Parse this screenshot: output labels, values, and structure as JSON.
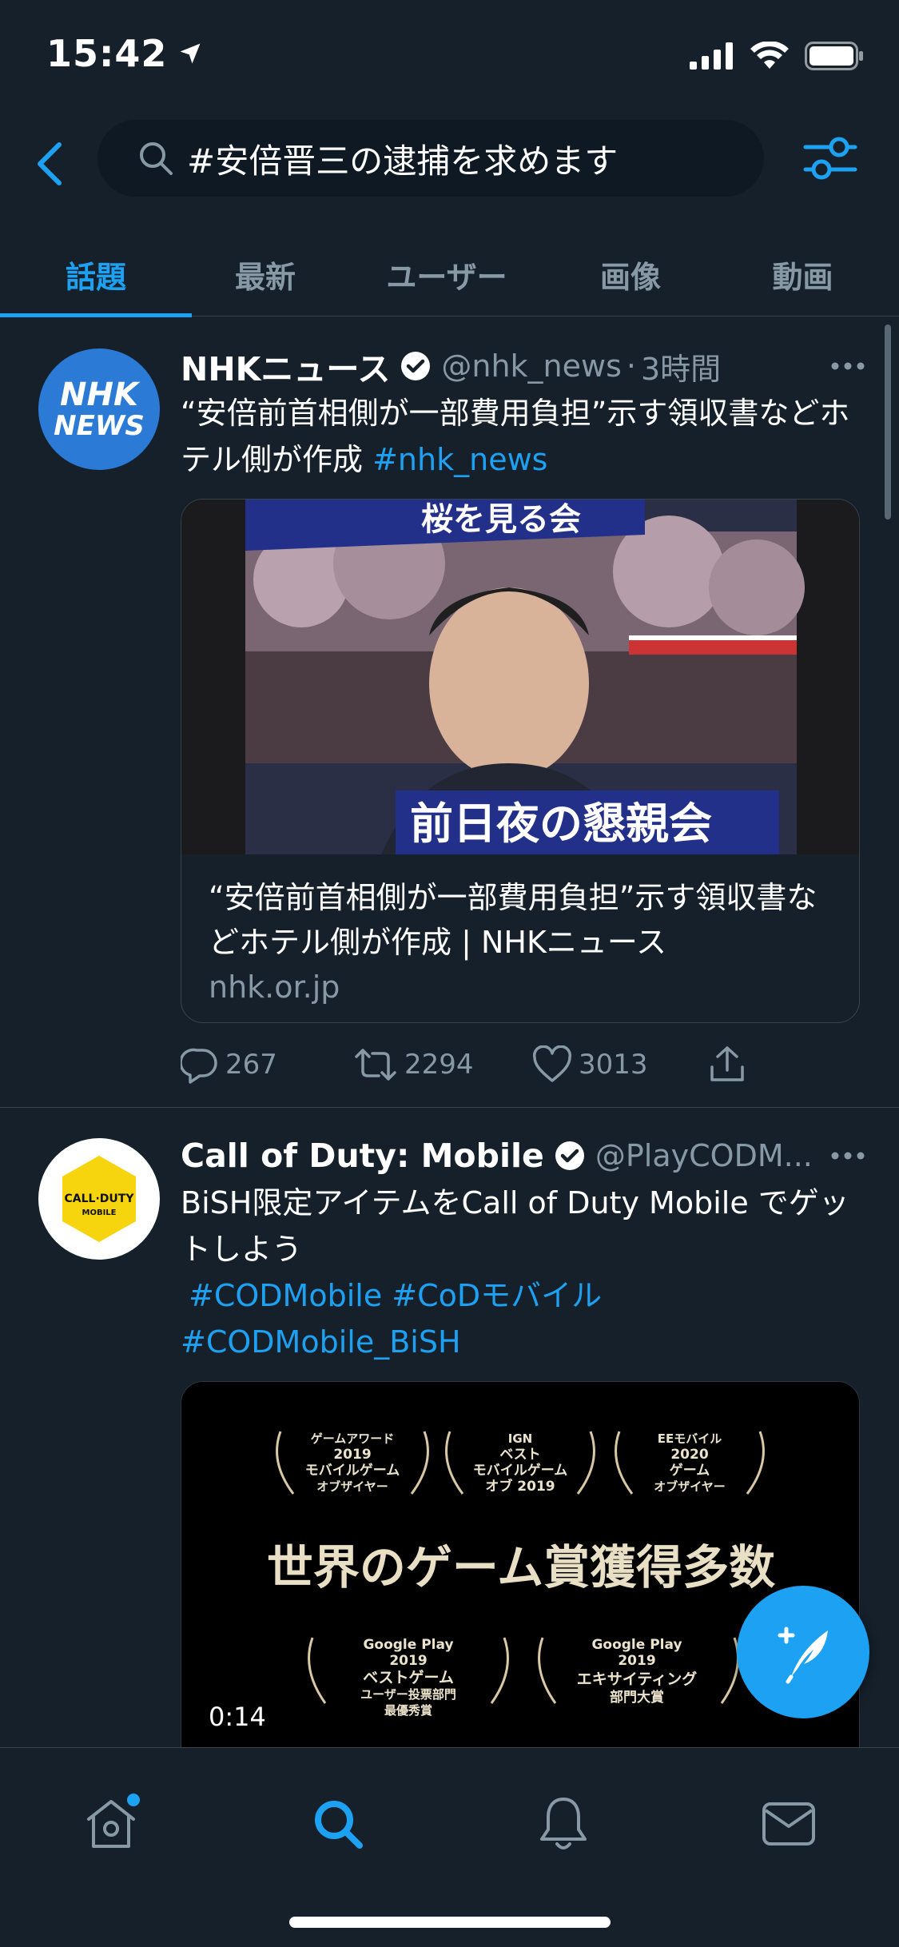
{
  "status_bar": {
    "time": "15:42"
  },
  "search": {
    "query": "#安倍晋三の逮捕を求めます"
  },
  "tabs": [
    {
      "label": "話題",
      "active": true
    },
    {
      "label": "最新",
      "active": false
    },
    {
      "label": "ユーザー",
      "active": false
    },
    {
      "label": "画像",
      "active": false
    },
    {
      "label": "動画",
      "active": false
    }
  ],
  "tweets": [
    {
      "display_name": "NHKニュース",
      "handle": "@nhk_news",
      "time": "3時間",
      "avatar_text": [
        "NHK",
        "NEWS"
      ],
      "avatar_color": "#2b7bd6",
      "text": "“安倍前首相側が一部費用負担”示す領収書などホテル側が作成 ",
      "hashtags": [
        "#nhk_news"
      ],
      "card": {
        "image_top_caption": "桜を見る会",
        "image_bottom_caption": "前日夜の懇親会",
        "title": "“安倍前首相側が一部費用負担”示す領収書などホテル側が作成 | NHKニュース",
        "domain": "nhk.or.jp"
      },
      "actions": {
        "replies": "267",
        "retweets": "2294",
        "likes": "3013"
      }
    },
    {
      "display_name": "Call of Duty: Mobile",
      "handle": "@PlayCODM...",
      "avatar_text": [
        "CALL·DUTY",
        "MOBILE"
      ],
      "text": "BiSH限定アイテムをCall of Duty Mobile でゲットしよう",
      "hashtags": [
        "#CODMobile",
        "#CoDモバイル",
        "#CODMobile_BiSH"
      ],
      "video": {
        "awards_top": [
          [
            "ゲームアワード",
            "2019",
            "モバイルゲーム",
            "オブザイヤー"
          ],
          [
            "IGN",
            "ベスト",
            "モバイルゲーム",
            "オブ 2019"
          ],
          [
            "EEモバイル",
            "2020",
            "ゲーム",
            "オブザイヤー"
          ]
        ],
        "headline": "世界のゲーム賞獲得多数",
        "awards_bottom": [
          [
            "Google Play",
            "2019",
            "ベストゲーム",
            "ユーザー投票部門",
            "最優秀賞"
          ],
          [
            "Google Play",
            "2019",
            "エキサイティング",
            "部門大賞"
          ]
        ],
        "duration": "0:14"
      }
    }
  ],
  "colors": {
    "background": "#15202b",
    "accent": "#1da1f2",
    "secondary_text": "#8899a6",
    "divider": "#38444d"
  }
}
